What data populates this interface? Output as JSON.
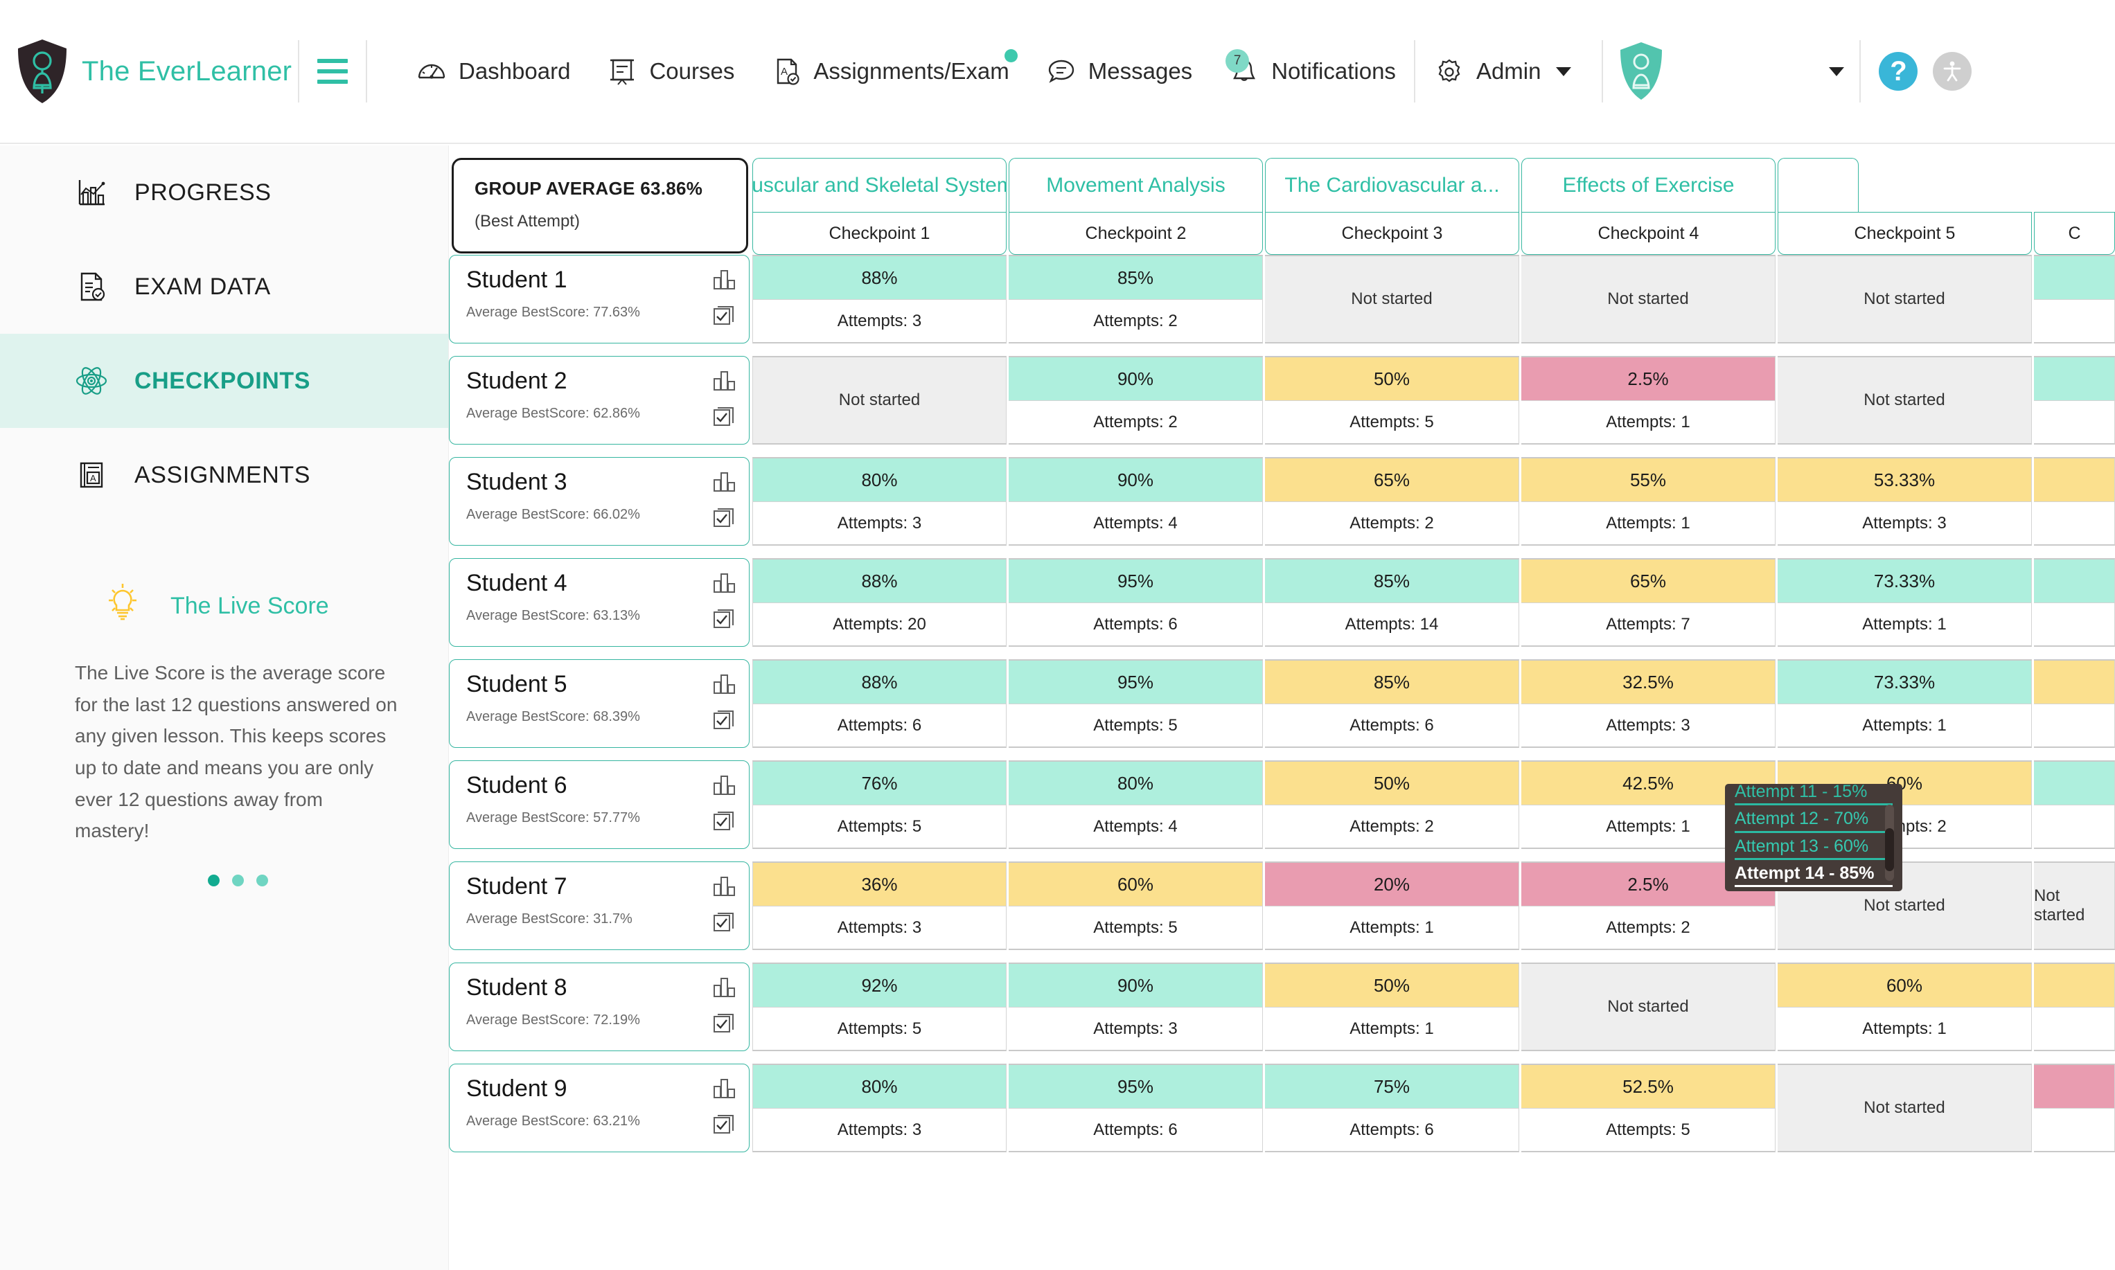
{
  "brand": {
    "name": "The EverLearner"
  },
  "topnav": {
    "items": [
      {
        "label": "Dashboard",
        "icon": "dashboard-gauge-icon"
      },
      {
        "label": "Courses",
        "icon": "courses-board-icon"
      },
      {
        "label": "Assignments/Exam",
        "icon": "assignments-doc-icon",
        "dot": true
      },
      {
        "label": "Messages",
        "icon": "messages-bubble-icon"
      },
      {
        "label": "Notifications",
        "icon": "bell-icon",
        "badge": "7"
      },
      {
        "label": "Admin",
        "icon": "gear-icon",
        "caret": true
      }
    ],
    "user_dropdown_value": "",
    "help_label": "?",
    "accessibility_label": "accessibility"
  },
  "sidebar": {
    "items": [
      {
        "label": "PROGRESS",
        "icon": "chart-progress-icon",
        "active": false
      },
      {
        "label": "EXAM DATA",
        "icon": "exam-document-icon",
        "active": false
      },
      {
        "label": "CHECKPOINTS",
        "icon": "atom-checkpoints-icon",
        "active": true
      },
      {
        "label": "ASSIGNMENTS",
        "icon": "assignments-book-icon",
        "active": false
      }
    ],
    "livescore": {
      "title": "The Live Score",
      "icon": "lightbulb-icon",
      "body": "The Live Score is the average score for the last 12 questions answered on any given lesson. This keeps scores up to date and means you are only ever 12 questions away from mastery!",
      "dots": 3
    }
  },
  "summary": {
    "title": "GROUP AVERAGE 63.86%",
    "subtitle": "(Best Attempt)"
  },
  "table": {
    "unit_headers": [
      "Muscular and Skeletal Systems",
      "Movement Analysis",
      "The Cardiovascular a...",
      "Effects of Exercise",
      ""
    ],
    "checkpoint_headers": [
      "Checkpoint 1",
      "Checkpoint 2",
      "Checkpoint 3",
      "Checkpoint 4",
      "Checkpoint 5",
      "C"
    ],
    "not_started_label": "Not started",
    "attempts_prefix": "Attempts:",
    "score_label_prefix": "Average BestScore:",
    "rows": [
      {
        "name": "Student 1",
        "score_label": "Average BestScore: 77.63%",
        "cells": [
          {
            "score": "88%",
            "attempts": "Attempts: 3",
            "color": "green"
          },
          {
            "score": "85%",
            "attempts": "Attempts: 2",
            "color": "green"
          },
          {
            "score": "Not started",
            "attempts": "",
            "color": "gray"
          },
          {
            "score": "Not started",
            "attempts": "",
            "color": "gray"
          },
          {
            "score": "Not started",
            "attempts": "",
            "color": "gray"
          },
          {
            "score": "",
            "attempts": "",
            "color": "green"
          }
        ]
      },
      {
        "name": "Student 2",
        "score_label": "Average BestScore: 62.86%",
        "cells": [
          {
            "score": "Not started",
            "attempts": "",
            "color": "gray"
          },
          {
            "score": "90%",
            "attempts": "Attempts: 2",
            "color": "green"
          },
          {
            "score": "50%",
            "attempts": "Attempts: 5",
            "color": "yellow"
          },
          {
            "score": "2.5%",
            "attempts": "Attempts: 1",
            "color": "pink"
          },
          {
            "score": "Not started",
            "attempts": "",
            "color": "gray"
          },
          {
            "score": "",
            "attempts": "",
            "color": "green"
          }
        ]
      },
      {
        "name": "Student 3",
        "score_label": "Average BestScore: 66.02%",
        "cells": [
          {
            "score": "80%",
            "attempts": "Attempts: 3",
            "color": "green"
          },
          {
            "score": "90%",
            "attempts": "Attempts: 4",
            "color": "green"
          },
          {
            "score": "65%",
            "attempts": "Attempts: 2",
            "color": "yellow"
          },
          {
            "score": "55%",
            "attempts": "Attempts: 1",
            "color": "yellow"
          },
          {
            "score": "53.33%",
            "attempts": "Attempts: 3",
            "color": "yellow"
          },
          {
            "score": "",
            "attempts": "",
            "color": "yellow"
          }
        ]
      },
      {
        "name": "Student 4",
        "score_label": "Average BestScore: 63.13%",
        "cells": [
          {
            "score": "88%",
            "attempts": "Attempts: 20",
            "color": "green"
          },
          {
            "score": "95%",
            "attempts": "Attempts: 6",
            "color": "green"
          },
          {
            "score": "85%",
            "attempts": "Attempts: 14",
            "color": "green"
          },
          {
            "score": "65%",
            "attempts": "Attempts: 7",
            "color": "yellow"
          },
          {
            "score": "73.33%",
            "attempts": "Attempts: 1",
            "color": "green"
          },
          {
            "score": "",
            "attempts": "",
            "color": "green"
          }
        ]
      },
      {
        "name": "Student 5",
        "score_label": "Average BestScore: 68.39%",
        "cells": [
          {
            "score": "88%",
            "attempts": "Attempts: 6",
            "color": "green"
          },
          {
            "score": "95%",
            "attempts": "Attempts: 5",
            "color": "green"
          },
          {
            "score": "85%",
            "attempts": "Attempts: 6",
            "color": "yellow"
          },
          {
            "score": "32.5%",
            "attempts": "Attempts: 3",
            "color": "yellow"
          },
          {
            "score": "73.33%",
            "attempts": "Attempts: 1",
            "color": "green"
          },
          {
            "score": "",
            "attempts": "",
            "color": "yellow"
          }
        ]
      },
      {
        "name": "Student 6",
        "score_label": "Average BestScore: 57.77%",
        "cells": [
          {
            "score": "76%",
            "attempts": "Attempts: 5",
            "color": "green"
          },
          {
            "score": "80%",
            "attempts": "Attempts: 4",
            "color": "green"
          },
          {
            "score": "50%",
            "attempts": "Attempts: 2",
            "color": "yellow"
          },
          {
            "score": "42.5%",
            "attempts": "Attempts: 1",
            "color": "yellow"
          },
          {
            "score": "60%",
            "attempts": "Attempts: 2",
            "color": "yellow"
          },
          {
            "score": "",
            "attempts": "",
            "color": "green"
          }
        ]
      },
      {
        "name": "Student 7",
        "score_label": "Average BestScore: 31.7%",
        "cells": [
          {
            "score": "36%",
            "attempts": "Attempts: 3",
            "color": "yellow"
          },
          {
            "score": "60%",
            "attempts": "Attempts: 5",
            "color": "yellow"
          },
          {
            "score": "20%",
            "attempts": "Attempts: 1",
            "color": "pink"
          },
          {
            "score": "2.5%",
            "attempts": "Attempts: 2",
            "color": "pink"
          },
          {
            "score": "Not started",
            "attempts": "",
            "color": "gray"
          },
          {
            "score": "Not started",
            "attempts": "",
            "color": "gray"
          }
        ]
      },
      {
        "name": "Student 8",
        "score_label": "Average BestScore: 72.19%",
        "cells": [
          {
            "score": "92%",
            "attempts": "Attempts: 5",
            "color": "green"
          },
          {
            "score": "90%",
            "attempts": "Attempts: 3",
            "color": "green"
          },
          {
            "score": "50%",
            "attempts": "Attempts: 1",
            "color": "yellow"
          },
          {
            "score": "Not started",
            "attempts": "",
            "color": "gray"
          },
          {
            "score": "60%",
            "attempts": "Attempts: 1",
            "color": "yellow"
          },
          {
            "score": "",
            "attempts": "",
            "color": "yellow"
          }
        ]
      },
      {
        "name": "Student 9",
        "score_label": "Average BestScore: 63.21%",
        "cells": [
          {
            "score": "80%",
            "attempts": "Attempts: 3",
            "color": "green"
          },
          {
            "score": "95%",
            "attempts": "Attempts: 6",
            "color": "green"
          },
          {
            "score": "75%",
            "attempts": "Attempts: 6",
            "color": "green"
          },
          {
            "score": "52.5%",
            "attempts": "Attempts: 5",
            "color": "yellow"
          },
          {
            "score": "Not started",
            "attempts": "",
            "color": "gray"
          },
          {
            "score": "",
            "attempts": "",
            "color": "pink"
          }
        ]
      }
    ]
  },
  "tooltip": {
    "lines": [
      "Attempt 11 - 15%",
      "Attempt 12 - 70%",
      "Attempt 13 - 60%",
      "Attempt 14 - 85%"
    ]
  },
  "colors": {
    "brand_teal": "#2fbfa5",
    "score_green": "#aeefdd",
    "score_yellow": "#fbe08e",
    "score_pink": "#e99cb0",
    "score_gray": "#eeeeee",
    "help_blue": "#39b6d8",
    "lightbulb_yellow": "#fdc62e"
  }
}
